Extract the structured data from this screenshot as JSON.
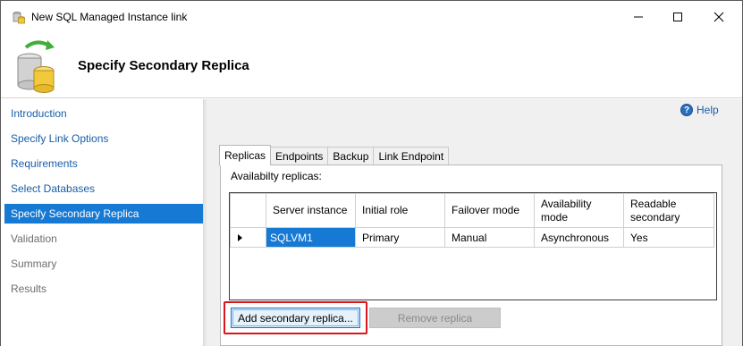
{
  "window": {
    "title": "New SQL Managed Instance link"
  },
  "header": {
    "title": "Specify Secondary Replica"
  },
  "nav": {
    "items": [
      {
        "label": "Introduction",
        "state": "link"
      },
      {
        "label": "Specify Link Options",
        "state": "link"
      },
      {
        "label": "Requirements",
        "state": "link"
      },
      {
        "label": "Select Databases",
        "state": "link"
      },
      {
        "label": "Specify Secondary Replica",
        "state": "selected"
      },
      {
        "label": "Validation",
        "state": "disabled"
      },
      {
        "label": "Summary",
        "state": "disabled"
      },
      {
        "label": "Results",
        "state": "disabled"
      }
    ]
  },
  "help": {
    "label": "Help"
  },
  "tabs": [
    {
      "label": "Replicas",
      "active": true
    },
    {
      "label": "Endpoints",
      "active": false
    },
    {
      "label": "Backup",
      "active": false
    },
    {
      "label": "Link Endpoint",
      "active": false
    }
  ],
  "replicas": {
    "label": "Availabilty replicas:",
    "columns": [
      "Server instance",
      "Initial role",
      "Failover mode",
      "Availability mode",
      "Readable secondary"
    ],
    "rows": [
      [
        "SQLVM1",
        "Primary",
        "Manual",
        "Asynchronous",
        "Yes"
      ]
    ]
  },
  "buttons": {
    "add": "Add secondary replica...",
    "remove": "Remove replica"
  },
  "colors": {
    "selection": "#1679d4",
    "link": "#1a5ea8",
    "highlight": "#d9161b"
  }
}
